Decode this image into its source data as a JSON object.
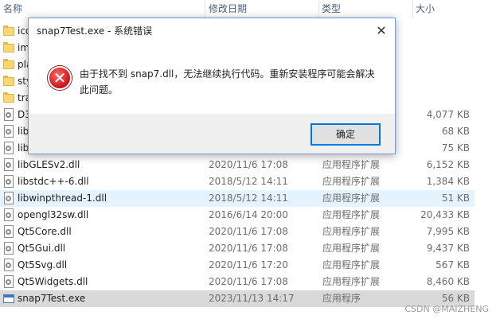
{
  "columns": {
    "name": "名称",
    "date": "修改日期",
    "type": "类型",
    "size": "大小"
  },
  "files": [
    {
      "name": "ico",
      "date": "",
      "type": "",
      "size": "",
      "icon": "folder-icon"
    },
    {
      "name": "im",
      "date": "",
      "type": "",
      "size": "",
      "icon": "folder-icon"
    },
    {
      "name": "pla",
      "date": "",
      "type": "",
      "size": "",
      "icon": "folder-icon"
    },
    {
      "name": "sty",
      "date": "",
      "type": "",
      "size": "",
      "icon": "folder-icon"
    },
    {
      "name": "tra",
      "date": "",
      "type": "",
      "size": "",
      "icon": "folder-icon"
    },
    {
      "name": "D3",
      "date": "",
      "type": "",
      "size": "4,077 KB",
      "icon": "dll-file-icon"
    },
    {
      "name": "lib",
      "date": "",
      "type": "",
      "size": "68 KB",
      "icon": "dll-file-icon"
    },
    {
      "name": "lib",
      "date": "",
      "type": "",
      "size": "75 KB",
      "icon": "dll-file-icon"
    },
    {
      "name": "libGLESv2.dll",
      "date": "2020/11/6 17:08",
      "type": "应用程序扩展",
      "size": "6,152 KB",
      "icon": "dll-file-icon"
    },
    {
      "name": "libstdc++-6.dll",
      "date": "2018/5/12 14:11",
      "type": "应用程序扩展",
      "size": "1,384 KB",
      "icon": "dll-file-icon"
    },
    {
      "name": "libwinpthread-1.dll",
      "date": "2018/5/12 14:11",
      "type": "应用程序扩展",
      "size": "51 KB",
      "icon": "dll-file-icon"
    },
    {
      "name": "opengl32sw.dll",
      "date": "2016/6/14 20:00",
      "type": "应用程序扩展",
      "size": "20,433 KB",
      "icon": "dll-file-icon"
    },
    {
      "name": "Qt5Core.dll",
      "date": "2020/11/6 17:08",
      "type": "应用程序扩展",
      "size": "7,995 KB",
      "icon": "dll-file-icon"
    },
    {
      "name": "Qt5Gui.dll",
      "date": "2020/11/6 17:08",
      "type": "应用程序扩展",
      "size": "9,437 KB",
      "icon": "dll-file-icon"
    },
    {
      "name": "Qt5Svg.dll",
      "date": "2020/11/6 17:20",
      "type": "应用程序扩展",
      "size": "567 KB",
      "icon": "dll-file-icon"
    },
    {
      "name": "Qt5Widgets.dll",
      "date": "2020/11/6 17:08",
      "type": "应用程序扩展",
      "size": "8,460 KB",
      "icon": "dll-file-icon"
    },
    {
      "name": "snap7Test.exe",
      "date": "2023/11/13 14:17",
      "type": "应用程序",
      "size": "56 KB",
      "icon": "exe-file-icon"
    }
  ],
  "hovered_file": "libwinpthread-1.dll",
  "selected_file": "snap7Test.exe",
  "dialog": {
    "title": "snap7Test.exe - 系统错误",
    "close_glyph": "✕",
    "icon": "error-icon",
    "icon_glyph": "✕",
    "message": "由于找不到 snap7.dll，无法继续执行代码。重新安装程序可能会解决此问题。",
    "ok_label": "确定"
  },
  "watermark": "CSDN @MAIZHENG",
  "colors": {
    "hover_row": "#e5f3ff",
    "selected_row": "#d9d9d9",
    "ok_border": "#0078d7",
    "error_red": "#c81414"
  }
}
